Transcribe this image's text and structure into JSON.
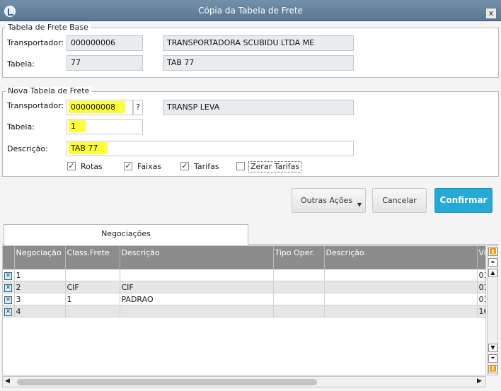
{
  "window": {
    "title": "Cópia da Tabela de Frete",
    "close_label": "x"
  },
  "base": {
    "legend": "Tabela de Frete Base",
    "transportador_label": "Transportador:",
    "transportador_code": "000000006",
    "transportador_name": "TRANSPORTADORA SCUBIDU LTDA ME",
    "tabela_label": "Tabela:",
    "tabela_code": "77",
    "tabela_desc": "TAB 77"
  },
  "nova": {
    "legend": "Nova Tabela de Frete",
    "transportador_label": "Transportador:",
    "transportador_code": "000000008",
    "lookup_label": "?",
    "transportador_name": "TRANSP LEVA",
    "tabela_label": "Tabela:",
    "tabela_code": "1",
    "descricao_label": "Descrição:",
    "descricao_value": "TAB 77",
    "options": [
      {
        "label": "Rotas",
        "checked": true
      },
      {
        "label": "Faixas",
        "checked": true
      },
      {
        "label": "Tarifas",
        "checked": true
      },
      {
        "label": "Zerar Tarifas",
        "checked": false
      }
    ],
    "highlight_color": "#ffff3a"
  },
  "actions": {
    "outras": "Outras Ações",
    "cancelar": "Cancelar",
    "confirmar": "Confirmar",
    "accent": "#27a9d6"
  },
  "tabs": {
    "active": "Negociações"
  },
  "grid": {
    "columns": [
      "Negociação",
      "Class.Frete",
      "Descrição",
      "Tipo Oper.",
      "Descrição",
      "Vi"
    ],
    "rows": [
      {
        "negociacao": "1",
        "class_frete": "",
        "descricao": "",
        "tipo_oper": "",
        "descricao2": "",
        "vi": "01"
      },
      {
        "negociacao": "2",
        "class_frete": "CIF",
        "descricao": "CIF",
        "tipo_oper": "",
        "descricao2": "",
        "vi": "01"
      },
      {
        "negociacao": "3",
        "class_frete": "1",
        "descricao": "PADRAO",
        "tipo_oper": "",
        "descricao2": "",
        "vi": "01"
      },
      {
        "negociacao": "4",
        "class_frete": "",
        "descricao": "",
        "tipo_oper": "",
        "descricao2": "",
        "vi": "16"
      }
    ]
  }
}
